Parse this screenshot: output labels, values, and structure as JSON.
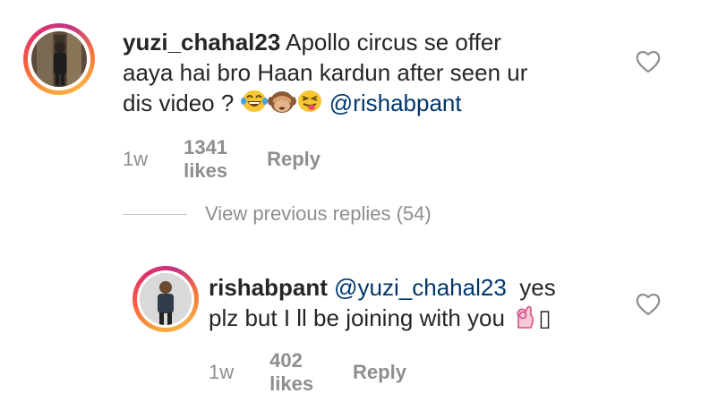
{
  "comment1": {
    "username": "yuzi_chahal23",
    "text_line1": "Apollo circus se offer",
    "text_line2": "aaya hai bro Haan kardun after seen ur",
    "text_line3": "dis video ?",
    "mention": "@rishabpant",
    "time": "1w",
    "likes": "1341 likes",
    "reply": "Reply"
  },
  "view_previous": "View previous replies (54)",
  "comment2": {
    "username": "rishabpant",
    "mention": "@yuzi_chahal23",
    "text_line1_after": "yes",
    "text_line2": "plz but I ll be joining with you",
    "trailing_glyph": "▯",
    "time": "1w",
    "likes": "402 likes",
    "reply": "Reply"
  },
  "icons": {
    "heart": "heart-outline-icon",
    "emoji1": "grinning-tears-emoji",
    "emoji2": "see-no-evil-monkey-emoji",
    "emoji3": "winking-tongue-emoji",
    "emoji4": "ok-hand-emoji"
  },
  "colors": {
    "text": "#262626",
    "muted": "#8e8e8e",
    "mention": "#00376b",
    "divider": "#c7c7c7"
  }
}
